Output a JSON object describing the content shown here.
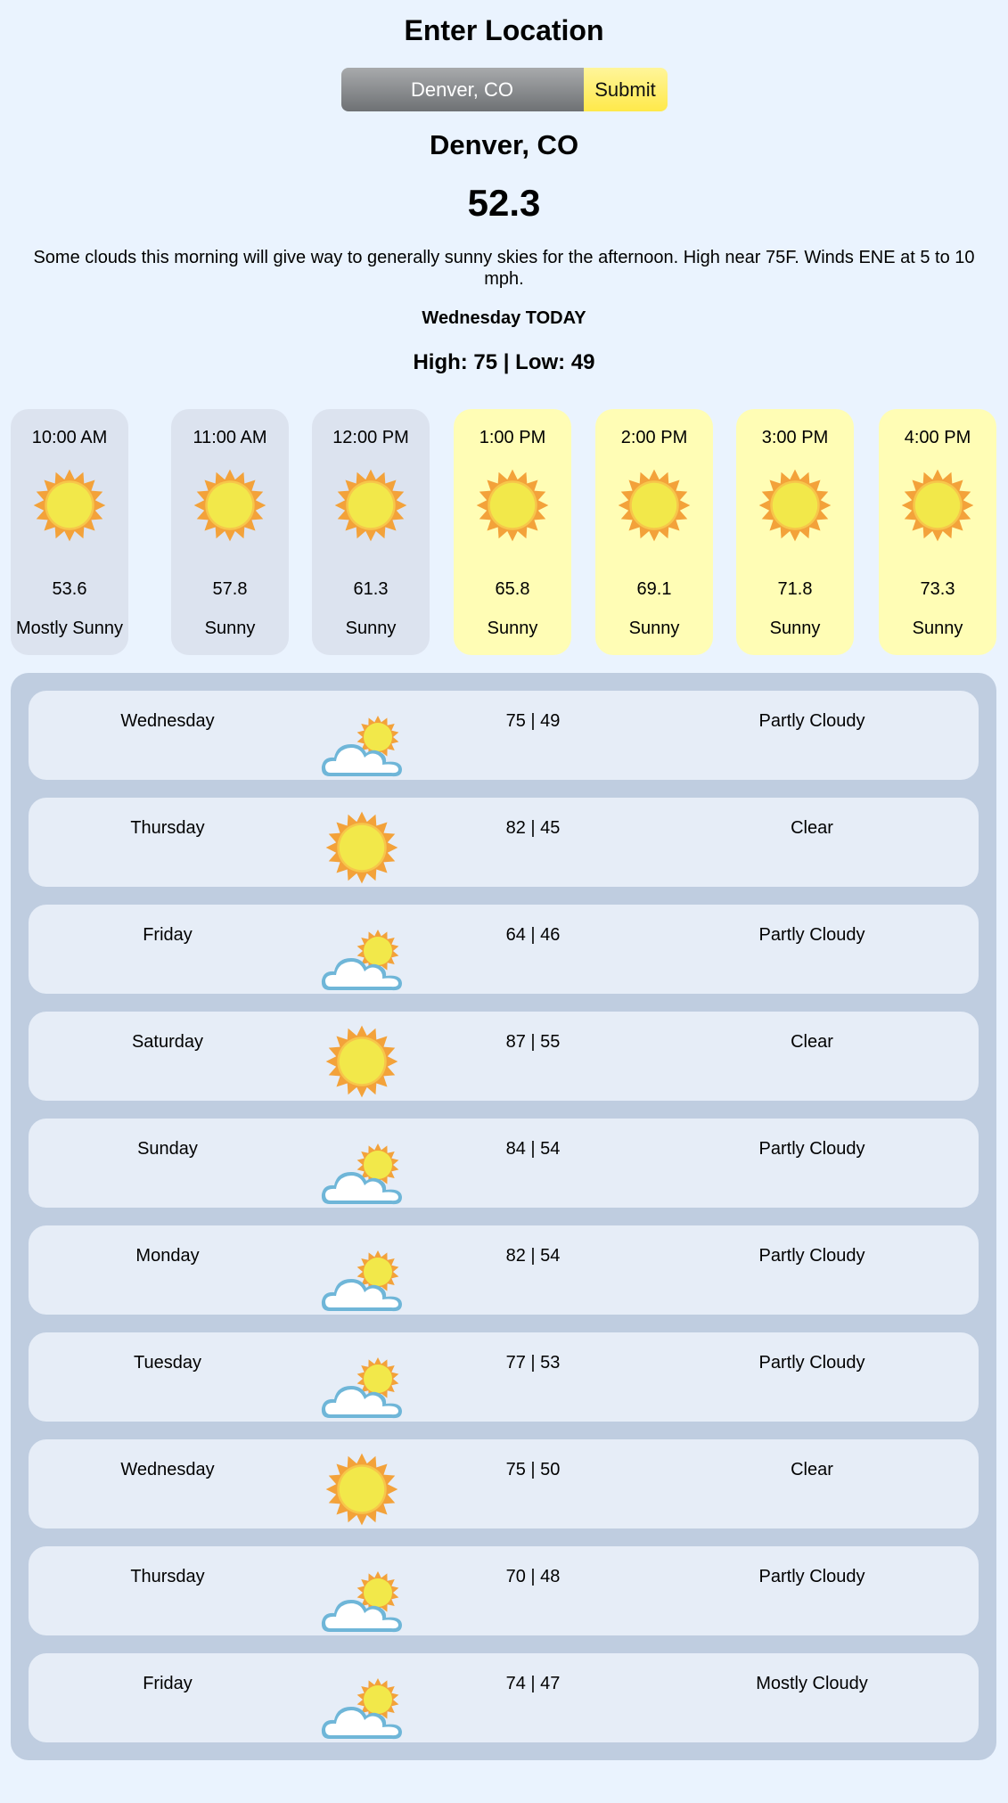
{
  "header": {
    "title": "Enter Location"
  },
  "search": {
    "value": "Denver, CO",
    "placeholder": "Denver, CO",
    "submit_label": "Submit"
  },
  "current": {
    "location": "Denver, CO",
    "temperature": "52.3",
    "summary": "Some clouds this morning will give way to generally sunny skies for the afternoon. High near 75F. Winds ENE at 5 to 10 mph.",
    "day": "Wednesday TODAY",
    "high_low": "High: 75 | Low: 49"
  },
  "hourly": [
    {
      "time": "10:00 AM",
      "temp": "53.6",
      "condition": "Mostly Sunny",
      "icon": "sun-icon",
      "state": "past"
    },
    {
      "time": "11:00 AM",
      "temp": "57.8",
      "condition": "Sunny",
      "icon": "sun-icon",
      "state": "past"
    },
    {
      "time": "12:00 PM",
      "temp": "61.3",
      "condition": "Sunny",
      "icon": "sun-icon",
      "state": "past"
    },
    {
      "time": "1:00 PM",
      "temp": "65.8",
      "condition": "Sunny",
      "icon": "sun-icon",
      "state": "future"
    },
    {
      "time": "2:00 PM",
      "temp": "69.1",
      "condition": "Sunny",
      "icon": "sun-icon",
      "state": "future"
    },
    {
      "time": "3:00 PM",
      "temp": "71.8",
      "condition": "Sunny",
      "icon": "sun-icon",
      "state": "future"
    },
    {
      "time": "4:00 PM",
      "temp": "73.3",
      "condition": "Sunny",
      "icon": "sun-icon",
      "state": "future"
    }
  ],
  "daily": [
    {
      "day": "Wednesday",
      "temps": "75 | 49",
      "condition": "Partly Cloudy",
      "icon": "partly-cloudy-icon"
    },
    {
      "day": "Thursday",
      "temps": "82 | 45",
      "condition": "Clear",
      "icon": "sun-icon"
    },
    {
      "day": "Friday",
      "temps": "64 | 46",
      "condition": "Partly Cloudy",
      "icon": "partly-cloudy-icon"
    },
    {
      "day": "Saturday",
      "temps": "87 | 55",
      "condition": "Clear",
      "icon": "sun-icon"
    },
    {
      "day": "Sunday",
      "temps": "84 | 54",
      "condition": "Partly Cloudy",
      "icon": "partly-cloudy-icon"
    },
    {
      "day": "Monday",
      "temps": "82 | 54",
      "condition": "Partly Cloudy",
      "icon": "partly-cloudy-icon"
    },
    {
      "day": "Tuesday",
      "temps": "77 | 53",
      "condition": "Partly Cloudy",
      "icon": "partly-cloudy-icon"
    },
    {
      "day": "Wednesday",
      "temps": "75 | 50",
      "condition": "Clear",
      "icon": "sun-icon"
    },
    {
      "day": "Thursday",
      "temps": "70 | 48",
      "condition": "Partly Cloudy",
      "icon": "partly-cloudy-icon"
    },
    {
      "day": "Friday",
      "temps": "74 | 47",
      "condition": "Mostly Cloudy",
      "icon": "partly-cloudy-icon"
    }
  ],
  "colors": {
    "page_bg": "#eaf3fe",
    "past_card": "#dce3ef",
    "future_card": "#fffdb5",
    "daily_panel": "#bfcde0",
    "daily_row": "#e6edf7",
    "submit": "#ffe94a",
    "sun_core": "#f2e84a",
    "sun_rays": "#f3a23a"
  }
}
